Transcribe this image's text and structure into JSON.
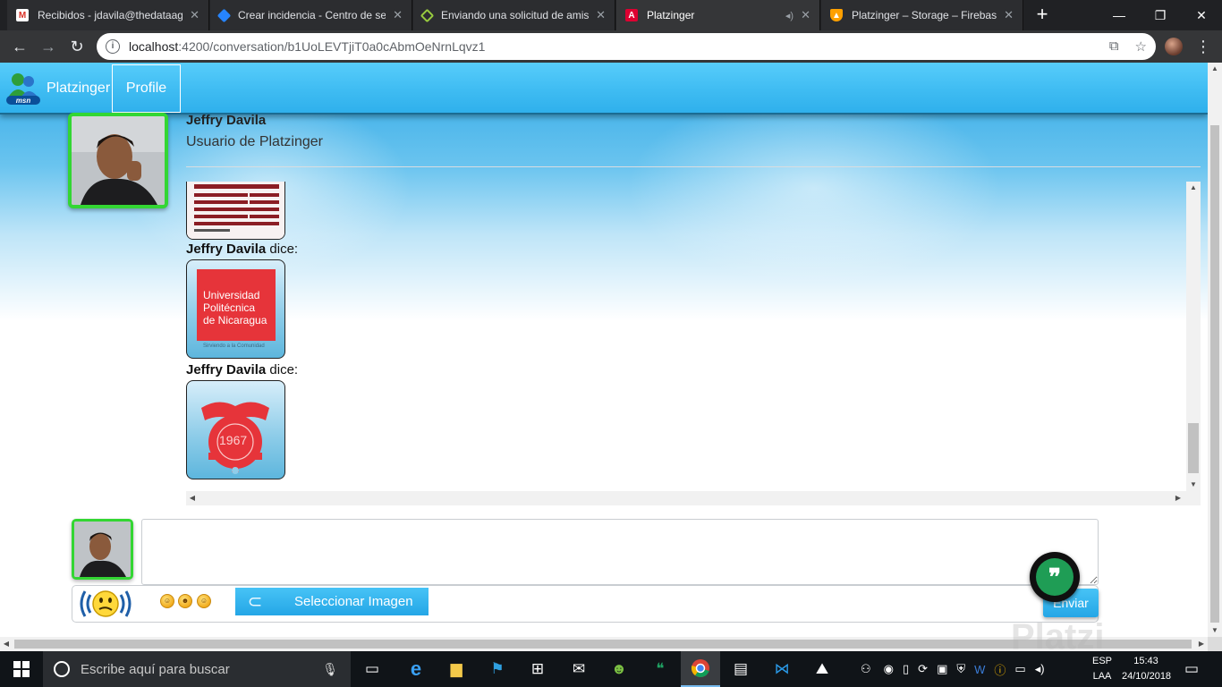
{
  "browser": {
    "tabs": [
      {
        "title": "Recibidos - jdavila@thedataag",
        "icon": "gmail-icon",
        "color": "#d93025"
      },
      {
        "title": "Crear incidencia - Centro de se",
        "icon": "jira-icon",
        "color": "#2684ff"
      },
      {
        "title": "Enviando una solicitud de amis",
        "icon": "platzi-icon",
        "color": "#98ca3f"
      },
      {
        "title": "Platzinger",
        "icon": "angular-icon",
        "color": "#dd0031"
      },
      {
        "title": "Platzinger – Storage – Firebase",
        "icon": "firebase-icon",
        "color": "#ffa000"
      }
    ],
    "new_tab_label": "+",
    "url_host": "localhost",
    "url_path": ":4200/conversation/b1UoLEVTjiT0a0cAbmOeNrnLqvz1"
  },
  "app": {
    "brand": "Platzinger",
    "nav_profile": "Profile"
  },
  "contact": {
    "name": "Jeffry Davila",
    "subtitle": "Usuario de Platzinger"
  },
  "messages": [
    {
      "author": "Jeffry Davila",
      "verb": "dice:",
      "image": "document-table-image"
    },
    {
      "author": "Jeffry Davila",
      "verb": "dice:",
      "image": "upc-logo-image",
      "image_text": [
        "Universidad",
        "Politécnica",
        "de Nicaragua"
      ],
      "image_caption": "Sirviendo a la Comunidad"
    },
    {
      "author": "Jeffry Davila",
      "verb": "dice:",
      "image": "upc-emblem-image",
      "image_text": [
        "1967"
      ]
    }
  ],
  "composer": {
    "message_value": "",
    "select_image_label": "Seleccionar Imagen",
    "send_label": "Enviar",
    "emojis": [
      "☺",
      "☻",
      "☺"
    ]
  },
  "watermark": "Platzi",
  "taskbar": {
    "search_placeholder": "Escribe aquí para buscar",
    "lang_line1": "ESP",
    "lang_line2": "LAA",
    "time": "15:43",
    "date": "24/10/2018"
  },
  "colors": {
    "accent": "#3fbcf2",
    "avatar_border": "#33d633",
    "fab": "#1f9d55"
  }
}
